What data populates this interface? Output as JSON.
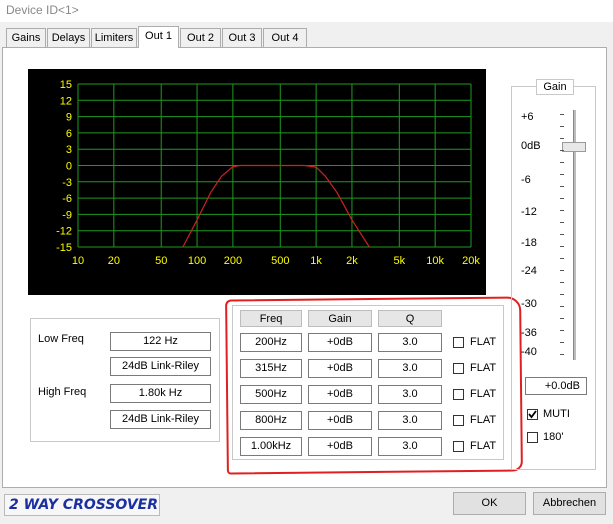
{
  "window": {
    "title": "Device ID<1>"
  },
  "tabs": [
    {
      "label": "Gains"
    },
    {
      "label": "Delays"
    },
    {
      "label": "Limiters"
    },
    {
      "label": "Out 1",
      "active": true
    },
    {
      "label": "Out 2"
    },
    {
      "label": "Out 3"
    },
    {
      "label": "Out 4"
    }
  ],
  "chart_data": {
    "type": "line",
    "x_scale": "log",
    "xlim": [
      10,
      20000
    ],
    "ylim": [
      -15,
      15
    ],
    "x_tick_labels": [
      "10",
      "20",
      "50",
      "100",
      "200",
      "500",
      "1k",
      "2k",
      "5k",
      "10k",
      "20k"
    ],
    "x_tick_values": [
      10,
      20,
      50,
      100,
      200,
      500,
      1000,
      2000,
      5000,
      10000,
      20000
    ],
    "y_tick_labels": [
      "15",
      "12",
      "9",
      "6",
      "3",
      "0",
      "-3",
      "-6",
      "-9",
      "-12",
      "-15"
    ],
    "y_tick_values": [
      15,
      12,
      9,
      6,
      3,
      0,
      -3,
      -6,
      -9,
      -12,
      -15
    ],
    "grid": true,
    "colors": {
      "background": "#000000",
      "grid": "#1f9a1f",
      "curve": "#cc2222",
      "tick_text": "#ffff00"
    },
    "series": [
      {
        "x": [
          76,
          100,
          130,
          160,
          200,
          230,
          300,
          500,
          800,
          1000,
          1200,
          1500,
          2000,
          2800
        ],
        "y": [
          -15,
          -10,
          -5,
          -2,
          -0.2,
          0,
          0,
          0,
          0,
          -0.3,
          -2,
          -5,
          -10,
          -15
        ]
      }
    ]
  },
  "crossover": {
    "low": {
      "label": "Low Freq",
      "freq": "122 Hz",
      "type": "24dB Link-Riley"
    },
    "high": {
      "label": "High Freq",
      "freq": "1.80k Hz",
      "type": "24dB Link-Riley"
    }
  },
  "eq": {
    "headers": {
      "freq": "Freq",
      "gain": "Gain",
      "q": "Q"
    },
    "flat_label": "FLAT",
    "rows": [
      {
        "freq": "200Hz",
        "gain": "+0dB",
        "q": "3.0"
      },
      {
        "freq": "315Hz",
        "gain": "+0dB",
        "q": "3.0"
      },
      {
        "freq": "500Hz",
        "gain": "+0dB",
        "q": "3.0"
      },
      {
        "freq": "800Hz",
        "gain": "+0dB",
        "q": "3.0"
      },
      {
        "freq": "1.00kHz",
        "gain": "+0dB",
        "q": "3.0"
      }
    ]
  },
  "gain": {
    "title": "Gain",
    "scale": [
      "+6",
      "0dB",
      "-6",
      "-12",
      "-18",
      "-24",
      "-30",
      "-36",
      "-40"
    ],
    "value": "+0.0dB",
    "slider_level_db": 0,
    "muti_label": "MUTI",
    "muti_checked": true,
    "phase_label": "180'",
    "phase_checked": false
  },
  "footer": {
    "brand": "2 WAY CROSSOVER",
    "ok": "OK",
    "cancel": "Abbrechen",
    "brand_color": "#1a2fa0"
  }
}
